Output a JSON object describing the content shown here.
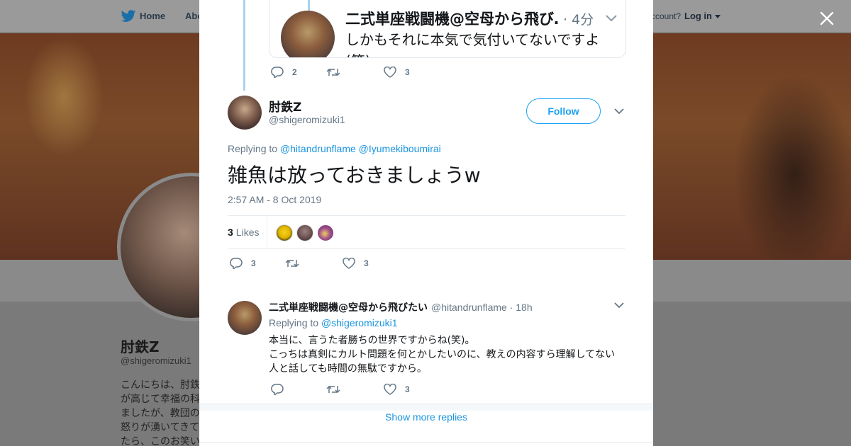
{
  "background": {
    "nav": {
      "home_label": "Home",
      "about_label": "Abo",
      "account_prompt": "ccount?",
      "login_label": "Log in"
    },
    "profile": {
      "name": "肘鉄Z",
      "handle": "@shigeromizuki1",
      "bio": "こんにちは、肘鉄\nが高じて幸福の科\nましたが、教団の\n怒りが湧いてきて\nたら、このお笑い"
    }
  },
  "quoted_tweet": {
    "author_name": "二式単座戦闘機@空母から飛び…",
    "time": "· 4分",
    "text": "しかもそれに本気で気付いてないですよ(笑)",
    "replies": "2",
    "retweets": "",
    "likes": "3"
  },
  "tweet": {
    "author_name": "肘鉄Z",
    "author_handle": "@shigeromizuki1",
    "follow_label": "Follow",
    "replying_prefix": "Replying to",
    "mentions": [
      "@hitandrunflame",
      "@Iyumekiboumirai"
    ],
    "text": "雑魚は放っておきましょうw",
    "timestamp": "2:57 AM - 8 Oct 2019",
    "likes_count": "3",
    "likes_label": "Likes",
    "replies": "3",
    "retweets": "",
    "likes": "3"
  },
  "reply": {
    "author_name": "二式単座戦闘機@空母から飛びたい",
    "author_handle": "@hitandrunflame",
    "time": "· 18h",
    "replying_prefix": "Replying to",
    "mention": "@shigeromizuki1",
    "text_line1": "本当に、言うた者勝ちの世界ですからね(笑)。",
    "text_line2": "こっちは真剣にカルト問題を何とかしたいのに、教えの内容すら理解してない人と話しても時間の無駄ですから。",
    "replies": "",
    "retweets": "",
    "likes": "3"
  },
  "show_more_label": "Show more replies",
  "colors": {
    "accent": "#1da1f2",
    "link": "#1b95e0",
    "muted": "#657786",
    "thread_line": "#a9d2ee"
  },
  "icons": [
    "twitter-bird-icon",
    "close-icon",
    "reply-icon",
    "retweet-icon",
    "like-icon",
    "chevron-down-icon",
    "caret-down-icon"
  ]
}
